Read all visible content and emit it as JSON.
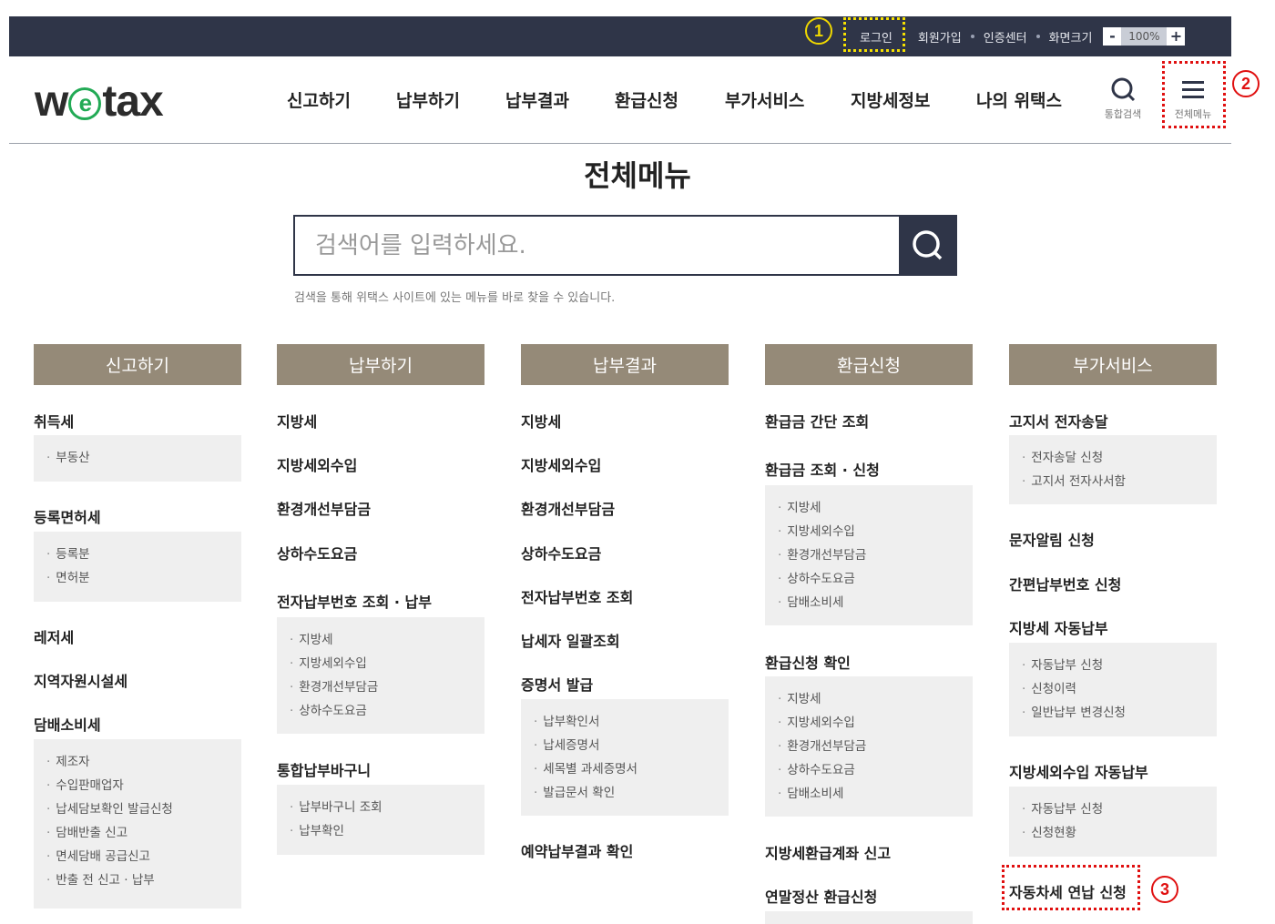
{
  "topbar": {
    "login": "로그인",
    "signup": "회원가입",
    "cert_center": "인증센터",
    "screen_size": "화면크기",
    "zoom_minus": "-",
    "zoom_value": "100%",
    "zoom_plus": "+"
  },
  "badges": {
    "one": "1",
    "two": "2",
    "three": "3"
  },
  "header": {
    "logo": {
      "prefix": "w",
      "e": "e",
      "suffix": "tax"
    },
    "nav": [
      "신고하기",
      "납부하기",
      "납부결과",
      "환급신청",
      "부가서비스",
      "지방세정보",
      "나의 위택스"
    ],
    "search_label": "통합검색",
    "menu_label": "전체메뉴"
  },
  "main": {
    "title": "전체메뉴",
    "search_placeholder": "검색어를 입력하세요.",
    "search_hint": "검색을 통해 위택스 사이트에 있는 메뉴를 바로 찾을 수 있습니다."
  },
  "columns": [
    {
      "head": "신고하기",
      "c0": "취득세",
      "c0s": [
        "부동산"
      ],
      "c1": "등록면허세",
      "c1s": [
        "등록분",
        "면허분"
      ],
      "c2": "레저세",
      "c3": "지역자원시설세",
      "c4": "담배소비세",
      "c4s": [
        "제조자",
        "수입판매업자",
        "납세담보확인 발급신청",
        "담배반출 신고",
        "면세담배 공급신고",
        "반출 전 신고 · 납부"
      ]
    },
    {
      "head": "납부하기",
      "c0": "지방세",
      "c1": "지방세외수입",
      "c2": "환경개선부담금",
      "c3": "상하수도요금",
      "c4": "전자납부번호 조회 · 납부",
      "c4s": [
        "지방세",
        "지방세외수입",
        "환경개선부담금",
        "상하수도요금"
      ],
      "c5": "통합납부바구니",
      "c5s": [
        "납부바구니 조회",
        "납부확인"
      ]
    },
    {
      "head": "납부결과",
      "c0": "지방세",
      "c1": "지방세외수입",
      "c2": "환경개선부담금",
      "c3": "상하수도요금",
      "c4": "전자납부번호 조회",
      "c5": "납세자 일괄조회",
      "c6": "증명서 발급",
      "c6s": [
        "납부확인서",
        "납세증명서",
        "세목별 과세증명서",
        "발급문서 확인"
      ],
      "c7": "예약납부결과 확인"
    },
    {
      "head": "환급신청",
      "c0": "환급금 간단 조회",
      "c1": "환급금 조회 · 신청",
      "c1s": [
        "지방세",
        "지방세외수입",
        "환경개선부담금",
        "상하수도요금",
        "담배소비세"
      ],
      "c2": "환급신청 확인",
      "c2s": [
        "지방세",
        "지방세외수입",
        "환경개선부담금",
        "상하수도요금",
        "담배소비세"
      ],
      "c3": "지방세환급계좌 신고",
      "c4": "연말정산 환급신청"
    },
    {
      "head": "부가서비스",
      "c0": "고지서 전자송달",
      "c0s": [
        "전자송달 신청",
        "고지서 전자사서함"
      ],
      "c1": "문자알림 신청",
      "c2": "간편납부번호 신청",
      "c3": "지방세 자동납부",
      "c3s": [
        "자동납부 신청",
        "신청이력",
        "일반납부 변경신청"
      ],
      "c4": "지방세외수입 자동납부",
      "c4s": [
        "자동납부 신청",
        "신청현황"
      ],
      "c5": "자동차세 연납 신청"
    }
  ]
}
